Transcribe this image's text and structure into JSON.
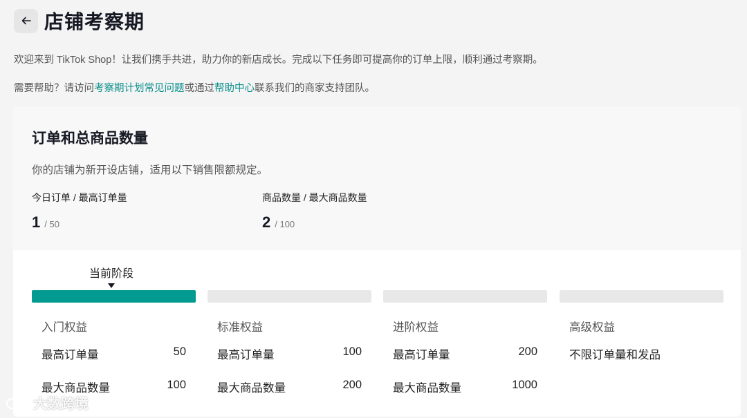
{
  "header": {
    "title": "店铺考察期"
  },
  "intro": "欢迎来到 TikTok Shop！让我们携手共进，助力你的新店成长。完成以下任务即可提高你的订单上限，顺利通过考察期。",
  "help": {
    "prefix": "需要帮助？请访问",
    "faq_link": "考察期计划常见问题",
    "middle": "或通过",
    "help_center_link": "帮助中心",
    "suffix": "联系我们的商家支持团队。"
  },
  "card": {
    "title": "订单和总商品数量",
    "description": "你的店铺为新开设店铺，适用以下销售限额规定。",
    "orders": {
      "label": "今日订单 / 最高订单量",
      "value": "1",
      "max": "/ 50"
    },
    "products": {
      "label": "商品数量 / 最大商品数量",
      "value": "2",
      "max": "/ 100"
    }
  },
  "current_stage_label": "当前阶段",
  "tiers": [
    {
      "name": "入门权益",
      "row1_label": "最高订单量",
      "row1_value": "50",
      "row2_label": "最大商品数量",
      "row2_value": "100",
      "active": true
    },
    {
      "name": "标准权益",
      "row1_label": "最高订单量",
      "row1_value": "100",
      "row2_label": "最大商品数量",
      "row2_value": "200",
      "active": false
    },
    {
      "name": "进阶权益",
      "row1_label": "最高订单量",
      "row1_value": "200",
      "row2_label": "最大商品数量",
      "row2_value": "1000",
      "active": false
    },
    {
      "name": "高级权益",
      "row1_label": "不限订单量和发品",
      "row1_value": "",
      "row2_label": "",
      "row2_value": "",
      "active": false
    }
  ],
  "watermark": "大数跨境",
  "colors": {
    "accent": "#029a91",
    "link": "#0b8f8c",
    "inactive_bar": "#e8e8e8"
  }
}
